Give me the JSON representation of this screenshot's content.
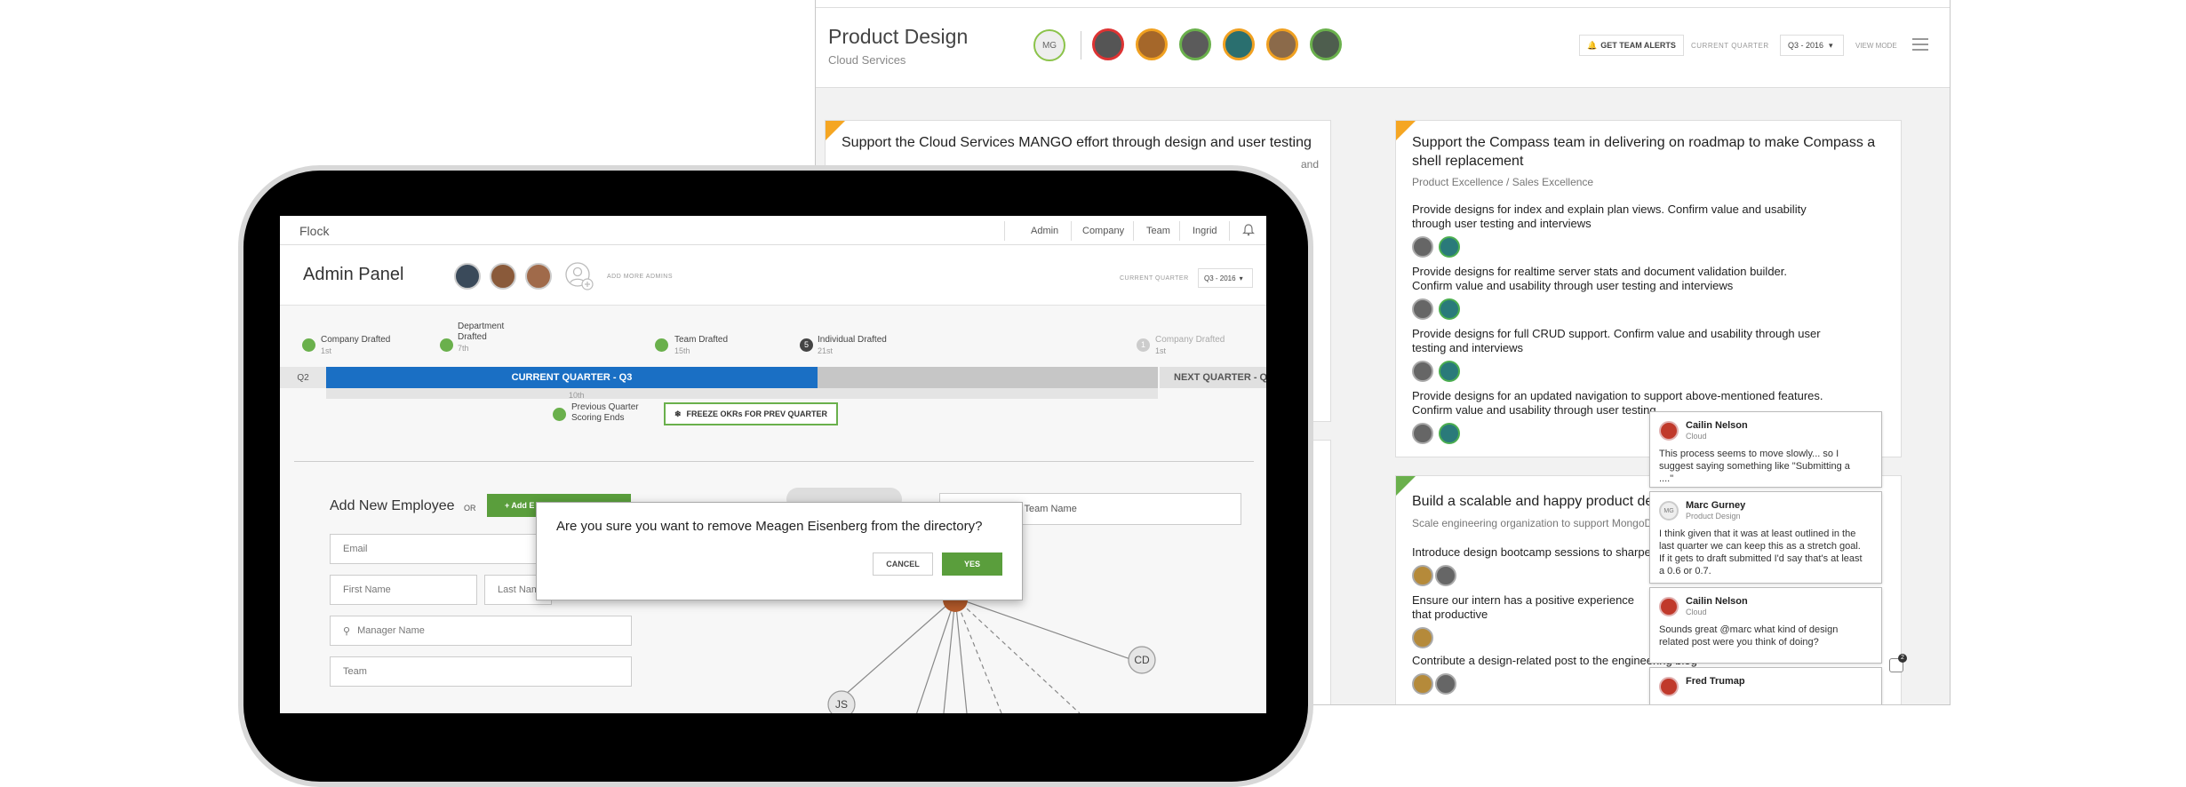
{
  "product_design": {
    "title": "Product Design",
    "subtitle": "Cloud Services",
    "mg_initials": "MG",
    "alerts_label": "GET TEAM ALERTS",
    "current_quarter_label": "CURRENT QUARTER",
    "quarter_value": "Q3 - 2016",
    "view_mode_label": "VIEW MODE",
    "card1": {
      "title": "Support the Cloud Services MANGO effort through design and user testing",
      "tail": "and"
    },
    "card2": {
      "title": "Support the Compass team in delivering on roadmap to make Compass a shell replacement",
      "subtitle": "Product Excellence / Sales Excellence",
      "krs": [
        "Provide designs for index and explain plan views. Confirm value and usability through user testing and interviews",
        "Provide designs for realtime server stats and document validation builder. Confirm value and usability through user testing and interviews",
        "Provide designs for full CRUD support. Confirm value and usability through user testing and interviews",
        "Provide designs for an updated navigation to support above-mentioned features. Confirm value and usability through user testing"
      ]
    },
    "card3": {
      "title": "Build a scalable and happy product des",
      "subtitle": "Scale engineering organization to support MongoDB",
      "krs": [
        "Introduce design bootcamp sessions to sharpen",
        "Ensure our intern has a positive experience that productive",
        "Contribute a design-related post to the engineering blog"
      ]
    },
    "comments": [
      {
        "name": "Cailin Nelson",
        "team": "Cloud",
        "text": "This process seems to move slowly... so I suggest saying something like \"Submitting a ....\""
      },
      {
        "name": "Marc Gurney",
        "team": "Product Design",
        "initials": "MG",
        "text": "I think given that it was at least outlined in the last quarter we can keep this as a stretch goal. If it gets to draft submitted I'd say that's at least a 0.6 or 0.7."
      },
      {
        "name": "Cailin Nelson",
        "team": "Cloud",
        "text": "Sounds great @marc what kind of design related post were you think of doing?"
      },
      {
        "name": "Fred Trumap",
        "team": ""
      }
    ],
    "notif_count": "2"
  },
  "flock": {
    "logo": "Flock",
    "nav": [
      "Admin",
      "Company",
      "Team",
      "Ingrid"
    ],
    "admin_title": "Admin Panel",
    "add_admins_label": "ADD MORE ADMINS",
    "current_quarter_label": "CURRENT QUARTER",
    "quarter_value": "Q3 - 2016",
    "milestones": [
      {
        "label": "Company Drafted",
        "sub": "1st"
      },
      {
        "label": "Department Drafted",
        "sub": "7th"
      },
      {
        "label": "Team Drafted",
        "sub": "15th"
      },
      {
        "label": "Individual Drafted",
        "sub": "21st",
        "num": "5"
      },
      {
        "label": "Company Drafted",
        "sub": "1st",
        "num": "1"
      },
      {
        "label": "Previous Quarter Scoring Ends",
        "sub": "10th"
      }
    ],
    "q2_label": "Q2",
    "current_quarter_bar": "CURRENT QUARTER - Q3",
    "next_quarter_bar": "NEXT QUARTER - Q4",
    "freeze_button": "FREEZE OKRs FOR PREV QUARTER",
    "add_employee_title": "Add New Employee",
    "or_label": "OR",
    "add_button": "+ Add E",
    "fields": {
      "email": "Email",
      "first_name": "First Name",
      "last_name": "Last Nam",
      "manager": "Manager Name",
      "team": "Team",
      "right_field": "r Team Name"
    },
    "graph_nodes": [
      "CD",
      "JS"
    ],
    "modal": {
      "text": "Are you sure you want to remove Meagen Eisenberg from the directory?",
      "cancel": "CANCEL",
      "yes": "YES"
    }
  },
  "colors": {
    "accent_green": "#5a9e3c",
    "accent_blue": "#1a6fc4",
    "flag_orange": "#f5a623"
  }
}
